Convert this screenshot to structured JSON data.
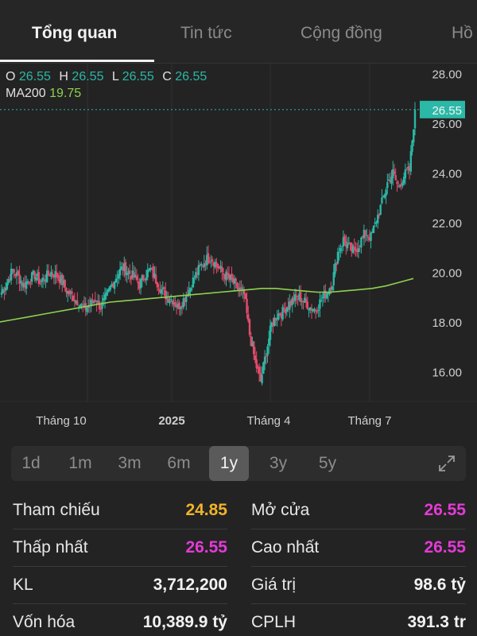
{
  "tabs": [
    "Tổng quan",
    "Tin tức",
    "Cộng đồng",
    "Hồ"
  ],
  "ohlc": {
    "o_label": "O",
    "o": "26.55",
    "h_label": "H",
    "h": "26.55",
    "l_label": "L",
    "l": "26.55",
    "c_label": "C",
    "c": "26.55",
    "ma_label": "MA200",
    "ma": "19.75"
  },
  "chart_data": {
    "type": "candlestick",
    "y_ticks": [
      "28.00",
      "26.00",
      "24.00",
      "22.00",
      "20.00",
      "18.00",
      "16.00"
    ],
    "ylim": [
      14.8,
      28.4
    ],
    "x_ticks": [
      "Tháng 10",
      "2025",
      "Tháng 4",
      "Tháng 7"
    ],
    "last_price": "26.55",
    "last_price_value": 26.55,
    "price_path": [
      19.2,
      19.6,
      20.1,
      19.8,
      19.5,
      19.7,
      19.9,
      19.6,
      19.8,
      20.0,
      19.9,
      19.6,
      19.2,
      19.0,
      18.8,
      18.5,
      18.7,
      18.9,
      18.6,
      19.0,
      19.5,
      19.9,
      20.2,
      20.0,
      19.8,
      19.5,
      19.9,
      20.1,
      19.7,
      19.3,
      19.0,
      18.9,
      18.6,
      18.9,
      19.3,
      19.8,
      20.2,
      20.5,
      20.6,
      20.3,
      20.0,
      19.8,
      19.6,
      19.3,
      19.1,
      17.5,
      16.4,
      15.6,
      16.8,
      17.9,
      18.3,
      18.4,
      18.7,
      18.9,
      19.0,
      18.8,
      18.6,
      18.5,
      18.9,
      19.2,
      19.6,
      20.8,
      21.3,
      21.0,
      20.8,
      21.2,
      21.6,
      21.4,
      22.1,
      22.8,
      23.6,
      24.0,
      23.4,
      23.9,
      24.1,
      26.55
    ],
    "ma200_path": [
      18.0,
      18.1,
      18.2,
      18.3,
      18.4,
      18.5,
      18.6,
      18.7,
      18.8,
      18.85,
      18.9,
      18.95,
      19.0,
      19.05,
      19.1,
      19.15,
      19.2,
      19.25,
      19.3,
      19.35,
      19.35,
      19.3,
      19.25,
      19.2,
      19.2,
      19.25,
      19.3,
      19.35,
      19.45,
      19.6,
      19.75
    ],
    "colors": {
      "up": "#2bb8a6",
      "down": "#e54b6c",
      "ma200": "#8fd14f",
      "price_line": "#2bb8a6"
    }
  },
  "range": {
    "options": [
      "1d",
      "1m",
      "3m",
      "6m",
      "1y",
      "3y",
      "5y"
    ],
    "selected": "1y"
  },
  "stats": {
    "ref_label": "Tham chiếu",
    "ref": "24.85",
    "open_label": "Mở cửa",
    "open": "26.55",
    "low_label": "Thấp nhất",
    "low": "26.55",
    "high_label": "Cao nhất",
    "high": "26.55",
    "vol_label": "KL",
    "vol": "3,712,200",
    "value_label": "Giá trị",
    "value": "98.6 tỷ",
    "cap_label": "Vốn hóa",
    "cap": "10,389.9 tỷ",
    "shares_label": "CPLH",
    "shares": "391.3 tr"
  },
  "colors": {
    "ref": "#f0b429",
    "ceiling": "#e33bd6",
    "neutral": "#f2f2f2"
  }
}
